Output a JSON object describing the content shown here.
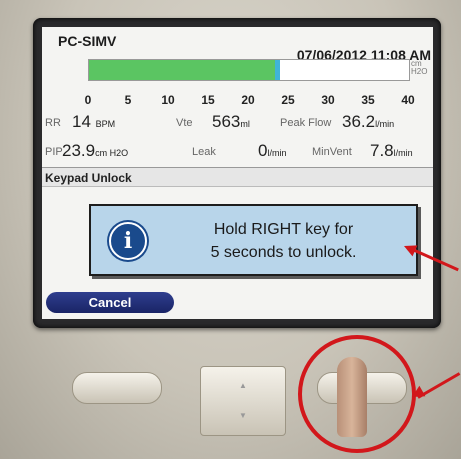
{
  "status_bar": {
    "mode": "PC-SIMV",
    "datetime": "07/06/2012 11:08 AM"
  },
  "pressure_bar": {
    "unit": "cm H2O",
    "value": 23.9,
    "scale_min": 0,
    "scale_max": 40,
    "scale_ticks": [
      "0",
      "5",
      "10",
      "15",
      "20",
      "25",
      "30",
      "35",
      "40"
    ]
  },
  "readings": {
    "rr": {
      "label": "RR",
      "value": "14",
      "unit": "BPM"
    },
    "vte": {
      "label": "Vte",
      "value": "563",
      "unit": "ml"
    },
    "peak_flow": {
      "label": "Peak Flow",
      "value": "36.2",
      "unit": "l/min"
    },
    "pip": {
      "label": "PIP",
      "value": "23.9",
      "unit": "cm H2O"
    },
    "leak": {
      "label": "Leak",
      "value": "0",
      "unit": "l/min"
    },
    "min_vent": {
      "label": "MinVent",
      "value": "7.8",
      "unit": "l/min"
    }
  },
  "dialog": {
    "title": "Keypad Unlock",
    "message_line1": "Hold RIGHT key for",
    "message_line2": "5 seconds to unlock.",
    "cancel_label": "Cancel"
  },
  "colors": {
    "bar_fill": "#5bc562",
    "bar_marker": "#3fb4d8",
    "dialog_bg": "#b8d5ea",
    "cancel_bg": "#1f2b75",
    "annotation": "#d2171b"
  }
}
